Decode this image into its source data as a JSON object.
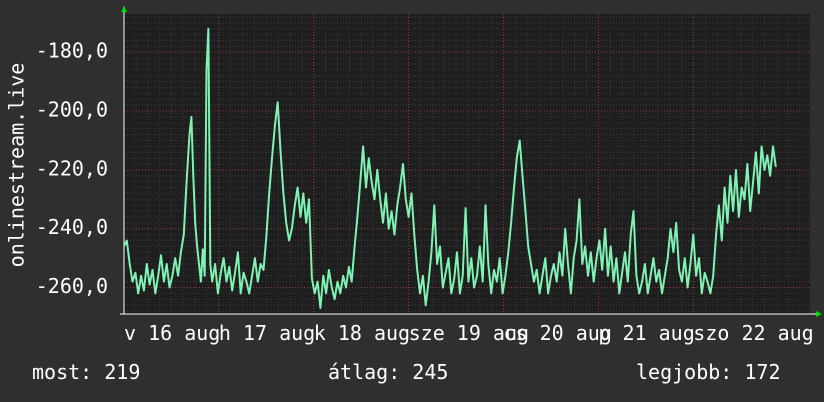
{
  "colors": {
    "background": "#2f2f2f",
    "plot_background": "#1e1e1e",
    "line": "#7ff2b4",
    "grid_minor": "#3a3a3a",
    "grid_major": "#8a3a3a",
    "arrow": "#00dd00",
    "text": "#ffffff"
  },
  "chart_data": {
    "type": "line",
    "ylabel": "onlinestream.live",
    "ylim": [
      -269,
      -167
    ],
    "yticks": [
      -180,
      -200,
      -220,
      -240,
      -260
    ],
    "ytick_labels": [
      "-180,0",
      "-200,0",
      "-220,0",
      "-240,0",
      "-260,0"
    ],
    "xlim": [
      0,
      7.23
    ],
    "xtick_labels": [
      {
        "x": 0.0,
        "label": "v 16 aug"
      },
      {
        "x": 1.0,
        "label": "h 17 aug"
      },
      {
        "x": 2.0,
        "label": "k 18 aug"
      },
      {
        "x": 3.0,
        "label": "sze 19 aug"
      },
      {
        "x": 4.0,
        "label": "cs 20 aug"
      },
      {
        "x": 5.0,
        "label": "p 21 aug"
      },
      {
        "x": 6.0,
        "label": "szo 22 aug"
      }
    ],
    "grid": true,
    "series": [
      {
        "values": [
          [
            0.0,
            -246
          ],
          [
            0.03,
            -244
          ],
          [
            0.06,
            -252
          ],
          [
            0.09,
            -258
          ],
          [
            0.12,
            -255
          ],
          [
            0.15,
            -262
          ],
          [
            0.18,
            -256
          ],
          [
            0.21,
            -261
          ],
          [
            0.24,
            -252
          ],
          [
            0.27,
            -259
          ],
          [
            0.3,
            -254
          ],
          [
            0.33,
            -262
          ],
          [
            0.36,
            -256
          ],
          [
            0.39,
            -249
          ],
          [
            0.42,
            -258
          ],
          [
            0.45,
            -252
          ],
          [
            0.48,
            -260
          ],
          [
            0.51,
            -256
          ],
          [
            0.54,
            -250
          ],
          [
            0.57,
            -256
          ],
          [
            0.6,
            -248
          ],
          [
            0.63,
            -242
          ],
          [
            0.66,
            -224
          ],
          [
            0.69,
            -208
          ],
          [
            0.71,
            -202
          ],
          [
            0.73,
            -222
          ],
          [
            0.75,
            -238
          ],
          [
            0.77,
            -246
          ],
          [
            0.79,
            -252
          ],
          [
            0.81,
            -258
          ],
          [
            0.83,
            -247
          ],
          [
            0.85,
            -256
          ],
          [
            0.87,
            -186
          ],
          [
            0.89,
            -172
          ],
          [
            0.91,
            -252
          ],
          [
            0.93,
            -258
          ],
          [
            0.96,
            -252
          ],
          [
            0.99,
            -262
          ],
          [
            1.02,
            -255
          ],
          [
            1.05,
            -250
          ],
          [
            1.08,
            -258
          ],
          [
            1.11,
            -253
          ],
          [
            1.14,
            -261
          ],
          [
            1.17,
            -255
          ],
          [
            1.2,
            -248
          ],
          [
            1.23,
            -262
          ],
          [
            1.26,
            -255
          ],
          [
            1.29,
            -258
          ],
          [
            1.32,
            -262
          ],
          [
            1.35,
            -256
          ],
          [
            1.38,
            -250
          ],
          [
            1.41,
            -258
          ],
          [
            1.44,
            -252
          ],
          [
            1.47,
            -254
          ],
          [
            1.5,
            -243
          ],
          [
            1.53,
            -228
          ],
          [
            1.56,
            -216
          ],
          [
            1.59,
            -205
          ],
          [
            1.62,
            -197
          ],
          [
            1.65,
            -214
          ],
          [
            1.68,
            -228
          ],
          [
            1.71,
            -238
          ],
          [
            1.74,
            -244
          ],
          [
            1.77,
            -240
          ],
          [
            1.8,
            -232
          ],
          [
            1.83,
            -226
          ],
          [
            1.86,
            -236
          ],
          [
            1.89,
            -228
          ],
          [
            1.92,
            -238
          ],
          [
            1.95,
            -230
          ],
          [
            1.98,
            -257
          ],
          [
            2.01,
            -262
          ],
          [
            2.04,
            -258
          ],
          [
            2.07,
            -267
          ],
          [
            2.1,
            -256
          ],
          [
            2.13,
            -262
          ],
          [
            2.16,
            -254
          ],
          [
            2.19,
            -260
          ],
          [
            2.22,
            -264
          ],
          [
            2.25,
            -258
          ],
          [
            2.28,
            -262
          ],
          [
            2.31,
            -256
          ],
          [
            2.34,
            -260
          ],
          [
            2.37,
            -253
          ],
          [
            2.4,
            -258
          ],
          [
            2.43,
            -246
          ],
          [
            2.46,
            -236
          ],
          [
            2.49,
            -224
          ],
          [
            2.52,
            -212
          ],
          [
            2.55,
            -226
          ],
          [
            2.58,
            -216
          ],
          [
            2.61,
            -224
          ],
          [
            2.64,
            -230
          ],
          [
            2.67,
            -220
          ],
          [
            2.7,
            -230
          ],
          [
            2.73,
            -238
          ],
          [
            2.76,
            -228
          ],
          [
            2.79,
            -240
          ],
          [
            2.82,
            -234
          ],
          [
            2.85,
            -242
          ],
          [
            2.88,
            -232
          ],
          [
            2.91,
            -226
          ],
          [
            2.94,
            -218
          ],
          [
            2.97,
            -230
          ],
          [
            3.0,
            -236
          ],
          [
            3.03,
            -228
          ],
          [
            3.06,
            -242
          ],
          [
            3.09,
            -254
          ],
          [
            3.12,
            -262
          ],
          [
            3.15,
            -256
          ],
          [
            3.18,
            -266
          ],
          [
            3.21,
            -258
          ],
          [
            3.24,
            -248
          ],
          [
            3.27,
            -232
          ],
          [
            3.3,
            -252
          ],
          [
            3.33,
            -246
          ],
          [
            3.36,
            -260
          ],
          [
            3.39,
            -255
          ],
          [
            3.42,
            -250
          ],
          [
            3.45,
            -262
          ],
          [
            3.48,
            -257
          ],
          [
            3.51,
            -248
          ],
          [
            3.54,
            -262
          ],
          [
            3.57,
            -256
          ],
          [
            3.6,
            -233
          ],
          [
            3.63,
            -258
          ],
          [
            3.66,
            -250
          ],
          [
            3.69,
            -260
          ],
          [
            3.72,
            -256
          ],
          [
            3.75,
            -246
          ],
          [
            3.78,
            -258
          ],
          [
            3.81,
            -232
          ],
          [
            3.84,
            -252
          ],
          [
            3.87,
            -262
          ],
          [
            3.9,
            -254
          ],
          [
            3.93,
            -258
          ],
          [
            3.96,
            -250
          ],
          [
            3.99,
            -262
          ],
          [
            4.02,
            -256
          ],
          [
            4.05,
            -248
          ],
          [
            4.08,
            -238
          ],
          [
            4.11,
            -226
          ],
          [
            4.14,
            -216
          ],
          [
            4.17,
            -210
          ],
          [
            4.2,
            -222
          ],
          [
            4.23,
            -234
          ],
          [
            4.26,
            -246
          ],
          [
            4.29,
            -252
          ],
          [
            4.32,
            -258
          ],
          [
            4.35,
            -254
          ],
          [
            4.38,
            -262
          ],
          [
            4.41,
            -256
          ],
          [
            4.44,
            -250
          ],
          [
            4.47,
            -262
          ],
          [
            4.5,
            -256
          ],
          [
            4.53,
            -252
          ],
          [
            4.56,
            -258
          ],
          [
            4.59,
            -248
          ],
          [
            4.62,
            -256
          ],
          [
            4.65,
            -240
          ],
          [
            4.68,
            -252
          ],
          [
            4.71,
            -262
          ],
          [
            4.74,
            -250
          ],
          [
            4.77,
            -244
          ],
          [
            4.8,
            -230
          ],
          [
            4.83,
            -252
          ],
          [
            4.86,
            -246
          ],
          [
            4.89,
            -256
          ],
          [
            4.92,
            -248
          ],
          [
            4.95,
            -258
          ],
          [
            4.98,
            -250
          ],
          [
            5.01,
            -244
          ],
          [
            5.04,
            -254
          ],
          [
            5.07,
            -240
          ],
          [
            5.1,
            -256
          ],
          [
            5.13,
            -246
          ],
          [
            5.16,
            -258
          ],
          [
            5.19,
            -250
          ],
          [
            5.22,
            -262
          ],
          [
            5.25,
            -255
          ],
          [
            5.28,
            -248
          ],
          [
            5.31,
            -258
          ],
          [
            5.34,
            -242
          ],
          [
            5.37,
            -234
          ],
          [
            5.4,
            -256
          ],
          [
            5.43,
            -262
          ],
          [
            5.46,
            -258
          ],
          [
            5.49,
            -252
          ],
          [
            5.52,
            -262
          ],
          [
            5.55,
            -256
          ],
          [
            5.58,
            -250
          ],
          [
            5.61,
            -258
          ],
          [
            5.64,
            -254
          ],
          [
            5.67,
            -262
          ],
          [
            5.7,
            -256
          ],
          [
            5.73,
            -250
          ],
          [
            5.76,
            -240
          ],
          [
            5.79,
            -248
          ],
          [
            5.82,
            -238
          ],
          [
            5.85,
            -254
          ],
          [
            5.88,
            -258
          ],
          [
            5.91,
            -250
          ],
          [
            5.94,
            -260
          ],
          [
            5.97,
            -252
          ],
          [
            6.0,
            -242
          ],
          [
            6.03,
            -256
          ],
          [
            6.06,
            -250
          ],
          [
            6.09,
            -262
          ],
          [
            6.12,
            -255
          ],
          [
            6.15,
            -258
          ],
          [
            6.18,
            -262
          ],
          [
            6.21,
            -256
          ],
          [
            6.24,
            -242
          ],
          [
            6.27,
            -232
          ],
          [
            6.3,
            -244
          ],
          [
            6.33,
            -226
          ],
          [
            6.36,
            -238
          ],
          [
            6.39,
            -222
          ],
          [
            6.42,
            -234
          ],
          [
            6.45,
            -220
          ],
          [
            6.48,
            -236
          ],
          [
            6.51,
            -226
          ],
          [
            6.54,
            -230
          ],
          [
            6.57,
            -218
          ],
          [
            6.6,
            -234
          ],
          [
            6.63,
            -224
          ],
          [
            6.66,
            -214
          ],
          [
            6.69,
            -228
          ],
          [
            6.72,
            -212
          ],
          [
            6.75,
            -220
          ],
          [
            6.78,
            -215
          ],
          [
            6.81,
            -222
          ],
          [
            6.84,
            -212
          ],
          [
            6.87,
            -219
          ]
        ]
      }
    ]
  },
  "footer": {
    "current": "most: 219",
    "average": "átlag: 245",
    "best": "legjobb: 172"
  }
}
